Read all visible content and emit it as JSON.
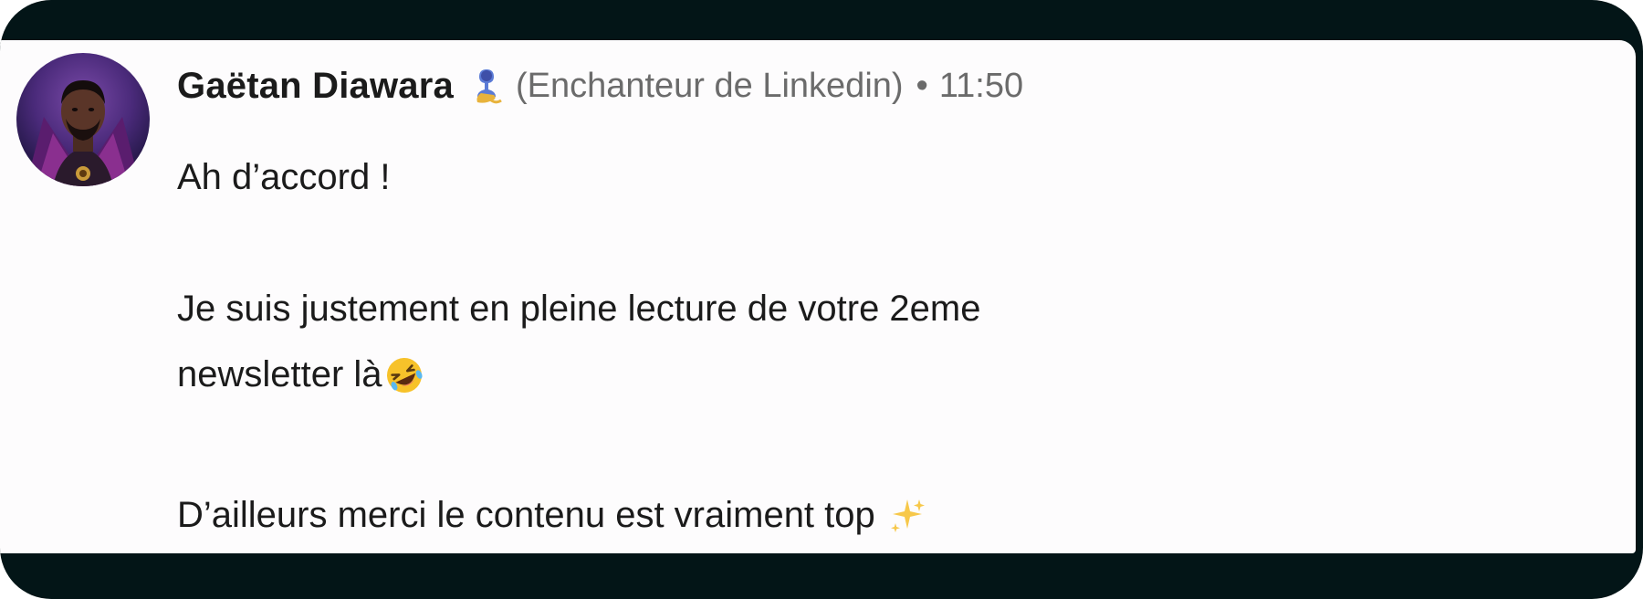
{
  "message": {
    "author": "Gaëtan Diawara",
    "author_badge_icon": "genie-emoji-icon",
    "author_title": "(Enchanteur de Linkedin)",
    "separator": "•",
    "time": "11:50",
    "lines": [
      "Ah d’accord !",
      "",
      "Je suis justement en pleine lecture de votre 2eme",
      "newsletter là",
      "",
      "D’ailleurs merci le contenu est vraiment top"
    ],
    "inline_emojis": {
      "line_4": "rolling-on-floor-laughing-emoji-icon",
      "line_6": "sparkles-emoji-icon"
    }
  },
  "colors": {
    "frame": "#031517",
    "card": "#fdfcfd",
    "text": "#1b1b1b",
    "muted": "#6b6b6b"
  }
}
